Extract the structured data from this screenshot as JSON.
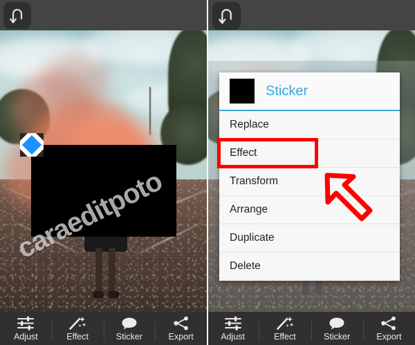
{
  "app": {
    "left_panel": {
      "undo_icon": "undo-arrow-icon",
      "watermark": "caraeditpoto",
      "sticker": {
        "name": "black-rectangle-sticker",
        "selected": true,
        "handle_icon": "resize-diamond-handle"
      }
    },
    "right_panel": {
      "undo_icon": "undo-arrow-icon",
      "dialog": {
        "thumbnail": "black-sticker-thumbnail",
        "title": "Sticker",
        "accent_color": "#36a9e1",
        "highlight_color": "#fd0000",
        "highlighted_item": "Effect",
        "pointer_icon": "red-arrow-pointer",
        "items": [
          {
            "label": "Replace"
          },
          {
            "label": "Effect"
          },
          {
            "label": "Transform"
          },
          {
            "label": "Arrange"
          },
          {
            "label": "Duplicate"
          },
          {
            "label": "Delete"
          }
        ]
      }
    },
    "toolbar": {
      "items": [
        {
          "label": "Adjust",
          "icon": "sliders-icon"
        },
        {
          "label": "Effect",
          "icon": "magic-wand-icon"
        },
        {
          "label": "Sticker",
          "icon": "speech-bubble-icon"
        },
        {
          "label": "Export",
          "icon": "share-icon"
        }
      ]
    }
  }
}
